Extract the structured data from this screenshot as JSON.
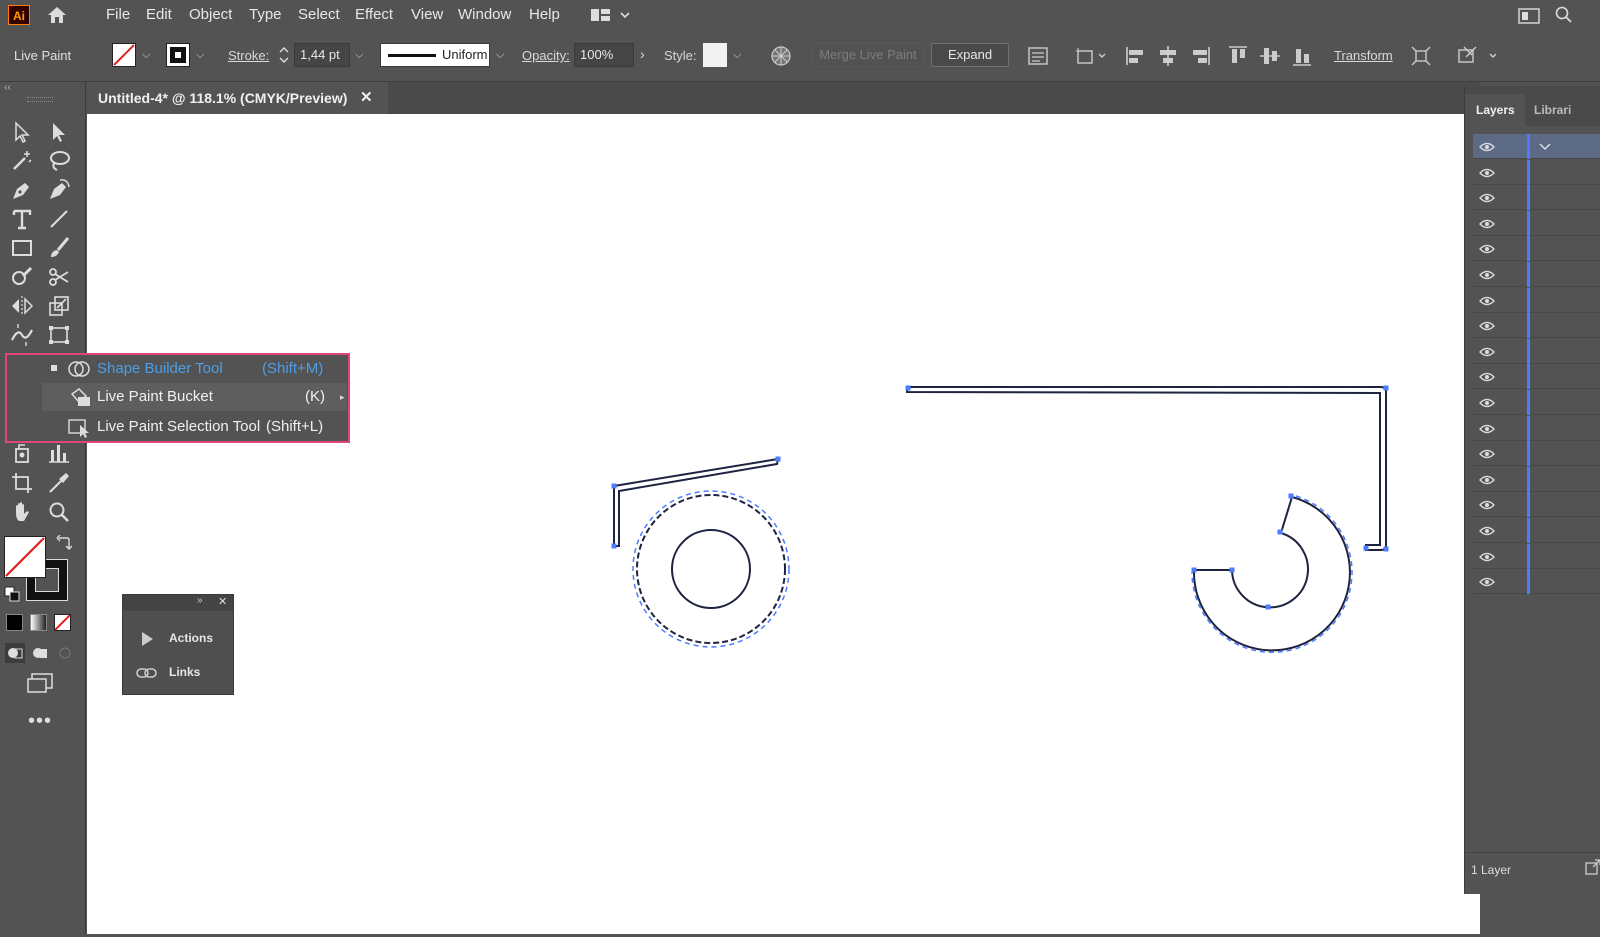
{
  "app": {
    "logo_text": "Ai",
    "accent": "#ff9a00"
  },
  "menu": {
    "items": [
      "File",
      "Edit",
      "Object",
      "Type",
      "Select",
      "Effect",
      "View",
      "Window",
      "Help"
    ]
  },
  "control": {
    "mode_label": "Live Paint",
    "stroke_label": "Stroke:",
    "stroke_value": "1,44 pt",
    "profile_value": "Uniform",
    "opacity_label": "Opacity:",
    "opacity_value": "100%",
    "style_label": "Style:",
    "merge_label": "Merge Live Paint",
    "expand_label": "Expand",
    "transform_label": "Transform"
  },
  "document": {
    "tab_title": "Untitled-4* @ 118.1% (CMYK/Preview)"
  },
  "flyout": {
    "items": [
      {
        "label": "Shape Builder Tool",
        "shortcut": "(Shift+M)",
        "active": true
      },
      {
        "label": "Live Paint Bucket",
        "shortcut": "(K)"
      },
      {
        "label": "Live Paint Selection Tool",
        "shortcut": "(Shift+L)"
      }
    ],
    "highlight_color": "#e0467a",
    "active_color": "#4d9ee8"
  },
  "mini_panel": {
    "items": [
      "Actions",
      "Links"
    ]
  },
  "layers": {
    "tabs": [
      "Layers",
      "Librari"
    ],
    "footer": "1 Layer",
    "selection_color": "#4b7bff"
  },
  "artwork": {
    "stroke_color": "#1e2340",
    "anchor_color": "#4b7bff"
  }
}
